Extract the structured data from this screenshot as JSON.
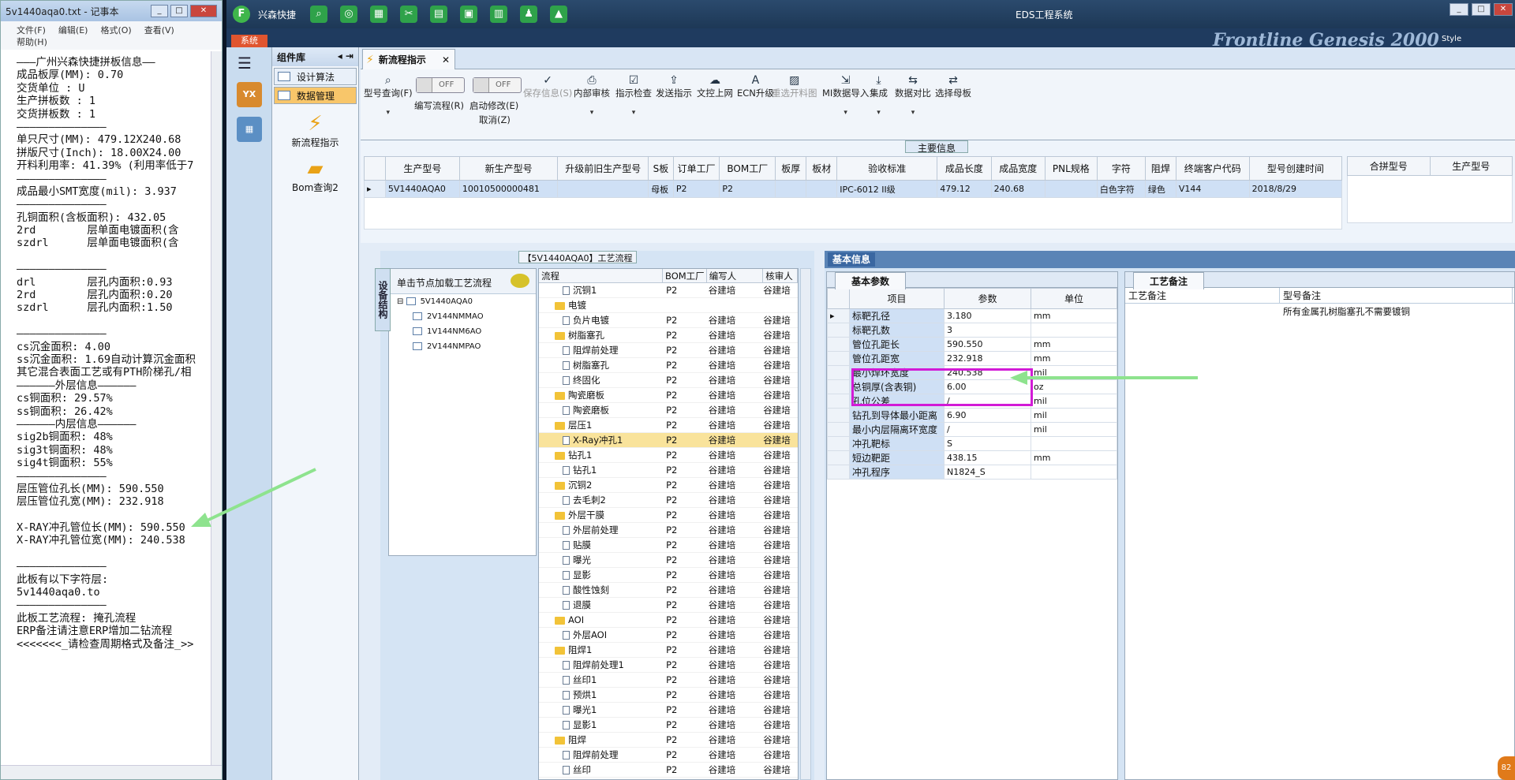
{
  "notepad": {
    "title": "5v1440aqa0.txt - 记事本",
    "menu": [
      "文件(F)",
      "编辑(E)",
      "格式(O)",
      "查看(V)",
      "帮助(H)"
    ],
    "lines": [
      "———广州兴森快捷拼板信息——",
      "成品板厚(MM): 0.70",
      "交货单位 : U",
      "生产拼板数 : 1",
      "交货拼板数 : 1",
      "——————————————",
      "单只尺寸(MM): 479.12X240.68",
      "拼版尺寸(Inch): 18.00X24.00",
      "开料利用率: 41.39% (利用率低于7",
      "——————————————",
      "成品最小SMT宽度(mil): 3.937",
      "——————————————",
      "孔铜面积(含板面积): 432.05",
      "2rd        层单面电镀面积(含",
      "szdrl      层单面电镀面积(含",
      "",
      "——————————————",
      "drl        层孔内面积:0.93",
      "2rd        层孔内面积:0.20",
      "szdrl      层孔内面积:1.50",
      "",
      "——————————————",
      "cs沉金面积: 4.00",
      "ss沉金面积: 1.69自动计算沉金面积",
      "其它混合表面工艺或有PTH阶梯孔/相",
      "——————外层信息——————",
      "cs铜面积: 29.57%",
      "ss铜面积: 26.42%",
      "——————内层信息——————",
      "sig2b铜面积: 48%",
      "sig3t铜面积: 48%",
      "sig4t铜面积: 55%",
      "——————————————",
      "层压管位孔长(MM): 590.550",
      "层压管位孔宽(MM): 232.918",
      "",
      "X-RAY冲孔管位长(MM): 590.550",
      "X-RAY冲孔管位宽(MM): 240.538",
      "",
      "——————————————",
      "此板有以下字符层:",
      "5v1440aqa0.to",
      "——————————————",
      "此板工艺流程: 掩孔流程",
      "ERP备注请注意ERP增加二钻流程",
      "<<<<<<<_请检查周期格式及备注_>>"
    ]
  },
  "app": {
    "name": "兴森快捷",
    "window_title": "EDS工程系统",
    "ribbon_tab": "系统",
    "brand": "Frontline Genesis 2000",
    "style_label": "Style"
  },
  "components": {
    "header": "组件库",
    "items": [
      "设计算法",
      "数据管理"
    ],
    "big_buttons": [
      "新流程指示",
      "Bom查询2"
    ]
  },
  "tab": {
    "label": "新流程指示"
  },
  "toolbar": {
    "query": "型号查询(F)",
    "edit_flow": "编写流程(R)",
    "edit_flow_state": "OFF",
    "start_modify": "启动修改(E)",
    "start_modify_state": "OFF",
    "cancel": "取消(Z)",
    "save": "保存信息(S)",
    "buttons": [
      "内部审核",
      "指示检查",
      "发送指示",
      "文控上网",
      "ECN升级",
      "重选开料图",
      "MI数据导入",
      "集成",
      "数据对比",
      "选择母板"
    ]
  },
  "main_info": {
    "caption": "主要信息",
    "columns": [
      "生产型号",
      "新生产型号",
      "升级前旧生产型号",
      "S板",
      "订单工厂",
      "BOM工厂",
      "板厚",
      "板材",
      "验收标准",
      "成品长度",
      "成品宽度",
      "PNL规格",
      "字符",
      "阻焊",
      "终端客户代码",
      "型号创建时间"
    ],
    "row": [
      "5V1440AQA0",
      "10010500000481",
      "",
      "母板",
      "P2",
      "P2",
      "",
      "",
      "IPC-6012 II级",
      "479.12",
      "240.68",
      "",
      "白色字符",
      "绿色",
      "V144",
      "2018/8/29"
    ],
    "side_columns": [
      "合拼型号",
      "生产型号"
    ]
  },
  "side_tab": "设备结构",
  "process": {
    "caption": "【5V1440AQA0】工艺流程",
    "tree_header": "单击节点加载工艺流程",
    "tree_root": "5V1440AQA0",
    "tree_children": [
      "2V144NMMAO",
      "1V144NM6AO",
      "2V144NMPAO"
    ],
    "columns": [
      "流程",
      "BOM工厂",
      "编写人",
      "核审人"
    ],
    "rows": [
      {
        "name": "沉铜1",
        "group": false,
        "bom": "P2",
        "author": "谷建培",
        "rev": "谷建培"
      },
      {
        "name": "电镀",
        "group": true,
        "bom": "",
        "author": "",
        "rev": ""
      },
      {
        "name": "负片电镀",
        "group": false,
        "bom": "P2",
        "author": "谷建培",
        "rev": "谷建培"
      },
      {
        "name": "树脂塞孔",
        "group": true,
        "bom": "P2",
        "author": "谷建培",
        "rev": "谷建培"
      },
      {
        "name": "阻焊前处理",
        "group": false,
        "bom": "P2",
        "author": "谷建培",
        "rev": "谷建培"
      },
      {
        "name": "树脂塞孔",
        "group": false,
        "bom": "P2",
        "author": "谷建培",
        "rev": "谷建培"
      },
      {
        "name": "终固化",
        "group": false,
        "bom": "P2",
        "author": "谷建培",
        "rev": "谷建培"
      },
      {
        "name": "陶瓷磨板",
        "group": true,
        "bom": "P2",
        "author": "谷建培",
        "rev": "谷建培"
      },
      {
        "name": "陶瓷磨板",
        "group": false,
        "bom": "P2",
        "author": "谷建培",
        "rev": "谷建培"
      },
      {
        "name": "层压1",
        "group": true,
        "bom": "P2",
        "author": "谷建培",
        "rev": "谷建培"
      },
      {
        "name": "X-Ray冲孔1",
        "group": false,
        "bom": "P2",
        "author": "谷建培",
        "rev": "谷建培",
        "sel": true
      },
      {
        "name": "钻孔1",
        "group": true,
        "bom": "P2",
        "author": "谷建培",
        "rev": "谷建培"
      },
      {
        "name": "钻孔1",
        "group": false,
        "bom": "P2",
        "author": "谷建培",
        "rev": "谷建培"
      },
      {
        "name": "沉铜2",
        "group": true,
        "bom": "P2",
        "author": "谷建培",
        "rev": "谷建培"
      },
      {
        "name": "去毛刺2",
        "group": false,
        "bom": "P2",
        "author": "谷建培",
        "rev": "谷建培"
      },
      {
        "name": "外层干膜",
        "group": true,
        "bom": "P2",
        "author": "谷建培",
        "rev": "谷建培"
      },
      {
        "name": "外层前处理",
        "group": false,
        "bom": "P2",
        "author": "谷建培",
        "rev": "谷建培"
      },
      {
        "name": "贴膜",
        "group": false,
        "bom": "P2",
        "author": "谷建培",
        "rev": "谷建培"
      },
      {
        "name": "曝光",
        "group": false,
        "bom": "P2",
        "author": "谷建培",
        "rev": "谷建培"
      },
      {
        "name": "显影",
        "group": false,
        "bom": "P2",
        "author": "谷建培",
        "rev": "谷建培"
      },
      {
        "name": "酸性蚀刻",
        "group": false,
        "bom": "P2",
        "author": "谷建培",
        "rev": "谷建培"
      },
      {
        "name": "退膜",
        "group": false,
        "bom": "P2",
        "author": "谷建培",
        "rev": "谷建培"
      },
      {
        "name": "AOI",
        "group": true,
        "bom": "P2",
        "author": "谷建培",
        "rev": "谷建培"
      },
      {
        "name": "外层AOI",
        "group": false,
        "bom": "P2",
        "author": "谷建培",
        "rev": "谷建培"
      },
      {
        "name": "阻焊1",
        "group": true,
        "bom": "P2",
        "author": "谷建培",
        "rev": "谷建培"
      },
      {
        "name": "阻焊前处理1",
        "group": false,
        "bom": "P2",
        "author": "谷建培",
        "rev": "谷建培"
      },
      {
        "name": "丝印1",
        "group": false,
        "bom": "P2",
        "author": "谷建培",
        "rev": "谷建培"
      },
      {
        "name": "预烘1",
        "group": false,
        "bom": "P2",
        "author": "谷建培",
        "rev": "谷建培"
      },
      {
        "name": "曝光1",
        "group": false,
        "bom": "P2",
        "author": "谷建培",
        "rev": "谷建培"
      },
      {
        "name": "显影1",
        "group": false,
        "bom": "P2",
        "author": "谷建培",
        "rev": "谷建培"
      },
      {
        "name": "阻焊",
        "group": true,
        "bom": "P2",
        "author": "谷建培",
        "rev": "谷建培"
      },
      {
        "name": "阻焊前处理",
        "group": false,
        "bom": "P2",
        "author": "谷建培",
        "rev": "谷建培"
      },
      {
        "name": "丝印",
        "group": false,
        "bom": "P2",
        "author": "谷建培",
        "rev": "谷建培"
      }
    ]
  },
  "basic": {
    "header": "基本信息",
    "params_tab": "基本参数",
    "params_columns": [
      "项目",
      "参数",
      "单位"
    ],
    "params": [
      {
        "item": "标靶孔径",
        "value": "3.180",
        "unit": "mm"
      },
      {
        "item": "标靶孔数",
        "value": "3",
        "unit": ""
      },
      {
        "item": "管位孔距长",
        "value": "590.550",
        "unit": "mm"
      },
      {
        "item": "管位孔距宽",
        "value": "232.918",
        "unit": "mm"
      },
      {
        "item": "最小焊环宽度",
        "value": "240.538",
        "unit": "mil"
      },
      {
        "item": "总铜厚(含表铜)",
        "value": "6.00",
        "unit": "oz"
      },
      {
        "item": "孔位公差",
        "value": "/",
        "unit": "mil"
      },
      {
        "item": "钻孔到导体最小距离",
        "value": "6.90",
        "unit": "mil"
      },
      {
        "item": "最小内层隔离环宽度",
        "value": "/",
        "unit": "mil"
      },
      {
        "item": "冲孔靶标",
        "value": "S",
        "unit": ""
      },
      {
        "item": "短边靶距",
        "value": "438.15",
        "unit": "mm"
      },
      {
        "item": "冲孔程序",
        "value": "N1824_S",
        "unit": ""
      }
    ],
    "note_tab": "工艺备注",
    "note_columns": [
      "工艺备注",
      "型号备注"
    ],
    "note_value": "所有金属孔树脂塞孔不需要镀铜"
  },
  "badge": "82"
}
